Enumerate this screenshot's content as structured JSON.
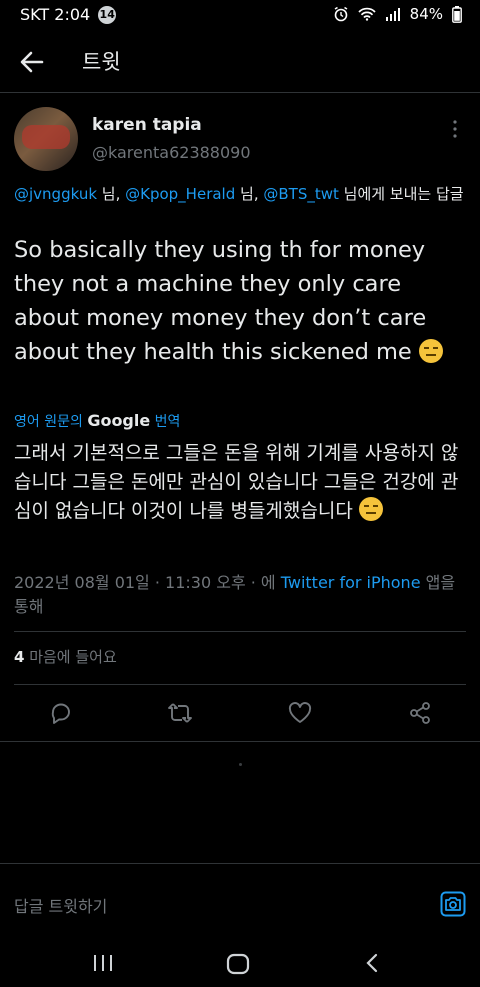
{
  "status_bar": {
    "carrier_time": "SKT 2:04",
    "badge_count": "14",
    "battery": "84%"
  },
  "header": {
    "title": "트윗"
  },
  "tweet": {
    "author_name": "karen tapia",
    "author_handle": "@karenta62388090",
    "replying_to": {
      "mention_1": "@jvnggkuk",
      "sep_1": " 님, ",
      "mention_2": "@Kpop_Herald",
      "sep_2": " 님, ",
      "mention_3": "@BTS_twt",
      "suffix": " 님에게 보내는 답글"
    },
    "text": "So basically they using th for money they not a machine they only care about money money they don’t care about they health this sickened me ",
    "text_emoji": "expressionless-face-emoji",
    "translate_prefix": "영어 원문의 ",
    "translate_brand": "Google",
    "translate_suffix": " 번역",
    "translated_text": "그래서 기본적으로 그들은 돈을 위해 기계를 사용하지 않습니다 그들은 돈에만 관심이 있습니다 그들은 건강에 관심이 없습니다 이것이 나를 병들게했습니다 ",
    "timestamp": "2022년 08월 01일 · 11:30 오후 · 에 ",
    "source": "Twitter for iPhone",
    "source_suffix": " 앱을 통해",
    "likes_count": "4",
    "likes_label": " 마음에 들어요"
  },
  "actions": [
    "reply-icon",
    "retweet-icon",
    "like-icon",
    "share-icon"
  ],
  "reply_bar": {
    "placeholder": "답글 트윗하기"
  },
  "colors": {
    "background": "#000000",
    "accent": "#1d9bf0",
    "text": "#e7e9ea",
    "muted": "#71767b",
    "divider": "#2f3336"
  }
}
